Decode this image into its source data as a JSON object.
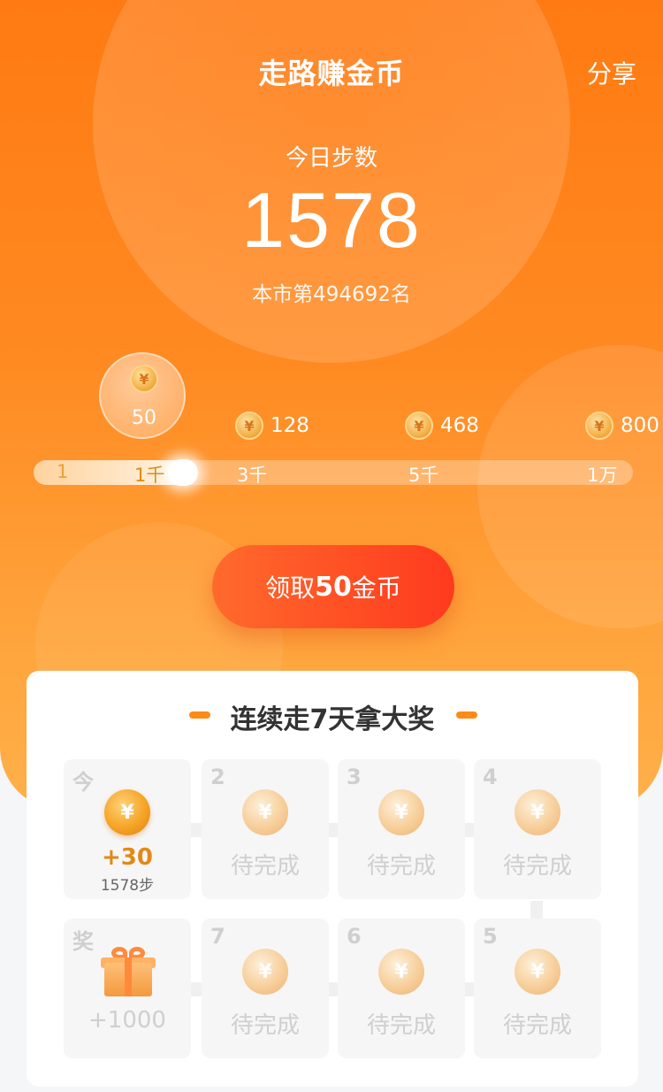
{
  "header": {
    "title": "走路赚金币",
    "share": "分享"
  },
  "steps": {
    "label": "今日步数",
    "count": "1578",
    "rank": "本市第494692名"
  },
  "bubble": {
    "amount": "50"
  },
  "milestones": [
    {
      "amount": "128"
    },
    {
      "amount": "468"
    },
    {
      "amount": "800"
    }
  ],
  "progress": {
    "ticks": [
      "1",
      "1千",
      "3千",
      "5千",
      "1万"
    ],
    "fraction": 0.27
  },
  "claim": {
    "prefix": "领取",
    "amount": "50",
    "suffix": "金币"
  },
  "streak": {
    "title": "连续走7天拿大奖",
    "today": {
      "label": "今",
      "plus": "+30",
      "steps": "1578步"
    },
    "days": [
      {
        "num": "2",
        "status": "待完成"
      },
      {
        "num": "3",
        "status": "待完成"
      },
      {
        "num": "4",
        "status": "待完成"
      },
      {
        "num": "5",
        "status": "待完成"
      },
      {
        "num": "6",
        "status": "待完成"
      },
      {
        "num": "7",
        "status": "待完成"
      }
    ],
    "prize": {
      "label": "奖",
      "amount": "+1000"
    }
  },
  "icons": {
    "coin": "yen-coin-icon",
    "gift": "gift-icon"
  },
  "colors": {
    "accent": "#ff7a12",
    "button": "#ff4a24",
    "coin": "#f5a426"
  }
}
